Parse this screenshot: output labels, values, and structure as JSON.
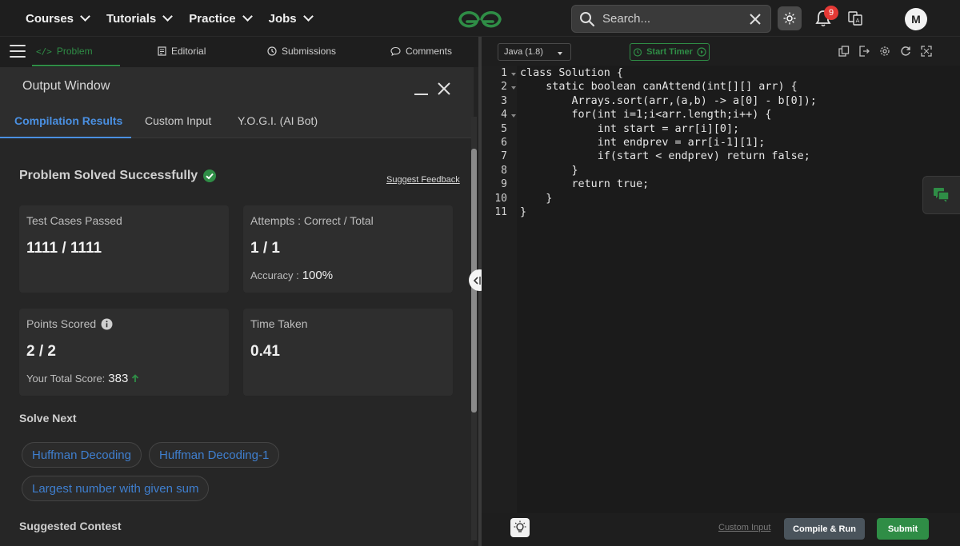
{
  "nav": {
    "items": [
      {
        "label": "Courses"
      },
      {
        "label": "Tutorials"
      },
      {
        "label": "Practice"
      },
      {
        "label": "Jobs"
      }
    ],
    "search_placeholder": "Search...",
    "notification_count": "9",
    "avatar_initial": "M",
    "brand_color": "#2f8d46"
  },
  "problem_tabs": {
    "problem": "Problem",
    "editorial": "Editorial",
    "submissions": "Submissions",
    "comments": "Comments"
  },
  "output_window": {
    "title": "Output Window",
    "tabs": [
      "Compilation Results",
      "Custom Input",
      "Y.O.G.I. (AI Bot)"
    ],
    "status": "Problem Solved Successfully",
    "feedback": "Suggest Feedback",
    "cards": {
      "tests_label": "Test Cases Passed",
      "tests_value": "1111 / 1111",
      "attempts_label": "Attempts : Correct / Total",
      "attempts_value": "1 / 1",
      "accuracy_label": "Accuracy :",
      "accuracy_value": "100%",
      "points_label": "Points Scored",
      "points_value": "2 / 2",
      "total_label": "Your Total Score:",
      "total_value": "383",
      "time_label": "Time Taken",
      "time_value": "0.41"
    },
    "solve_next_label": "Solve Next",
    "solve_next": [
      "Huffman Decoding",
      "Huffman Decoding-1",
      "Largest number with given sum"
    ],
    "suggested_contest_label": "Suggested Contest"
  },
  "editor": {
    "language": "Java (1.8)",
    "timer_label": "Start Timer",
    "line_numbers": [
      "1",
      "2",
      "3",
      "4",
      "5",
      "6",
      "7",
      "8",
      "9",
      "10",
      "11"
    ],
    "code_lines": [
      "class Solution {",
      "    static boolean canAttend(int[][] arr) {",
      "        Arrays.sort(arr,(a,b) -> a[0] - b[0]);",
      "        for(int i=1;i<arr.length;i++) {",
      "            int start = arr[i][0];",
      "            int endprev = arr[i-1][1];",
      "            if(start < endprev) return false;",
      "        }",
      "        return true;",
      "    }",
      "}"
    ],
    "custom_input": "Custom Input",
    "compile_run": "Compile & Run",
    "submit": "Submit"
  },
  "icons": [
    "chevron-down-icon",
    "search-icon",
    "close-icon",
    "sun-icon",
    "bell-icon",
    "translate-icon",
    "menu-icon",
    "code-icon",
    "document-icon",
    "clock-icon",
    "comment-icon",
    "check-circle-icon",
    "info-icon",
    "arrow-up-icon",
    "resize-icon",
    "timer-icon",
    "copy-icon",
    "export-icon",
    "settings-icon",
    "refresh-icon",
    "fullscreen-icon",
    "chat-icon",
    "lightbulb-icon"
  ]
}
